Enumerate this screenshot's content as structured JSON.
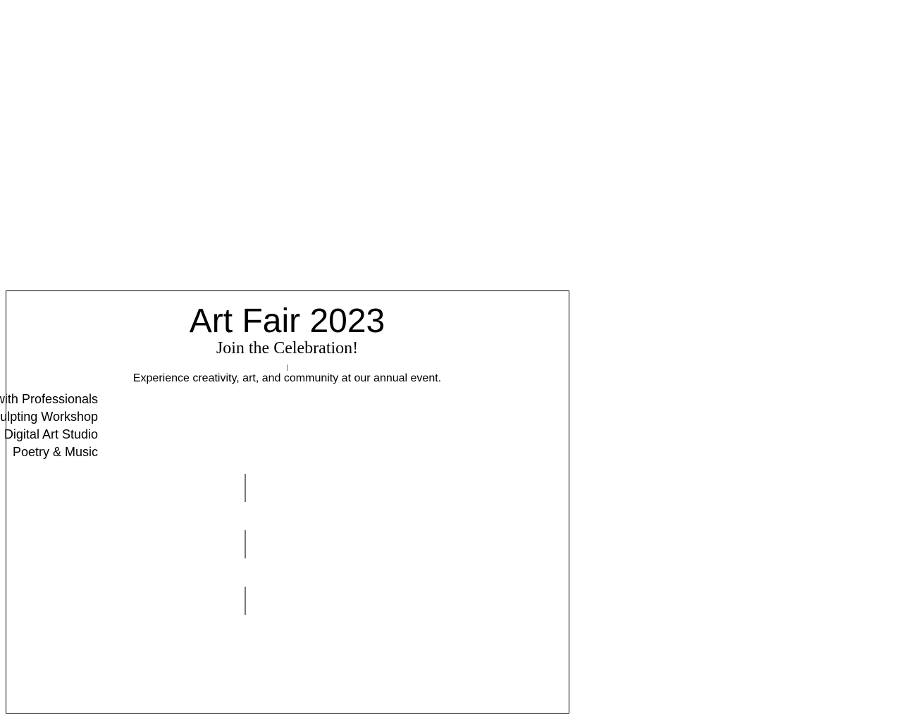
{
  "page": {
    "title": "Art Fair 2023",
    "subtitle": "Join the Celebration!",
    "description": "Experience creativity, art, and community at our annual event."
  },
  "events": [
    {
      "label": "Paint with Professionals"
    },
    {
      "label": "Sculpting Workshop"
    },
    {
      "label": "Digital Art Studio"
    },
    {
      "label": "Poetry & Music"
    }
  ],
  "colors": {
    "background": "#ffffff",
    "text": "#000000",
    "border": "#000000",
    "divider": "#777777"
  }
}
